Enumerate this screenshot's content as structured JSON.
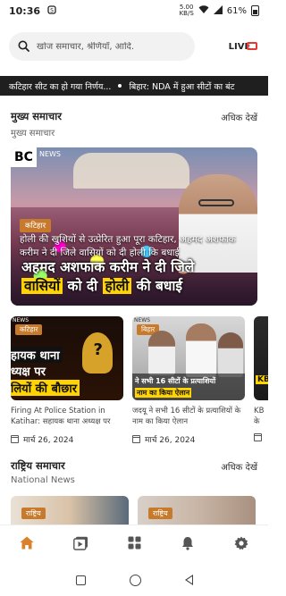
{
  "status_bar": {
    "time": "10:36",
    "speed_top": "5.00",
    "speed_bottom": "KB/S",
    "battery": "61%"
  },
  "header": {
    "search_placeholder": "खोज समाचार, श्रेणियाँ, आदि.",
    "live_label": "LIVE",
    "accent": "#e53935"
  },
  "ticker": {
    "items": [
      "कटिहार सीट का  हो गया निर्णय...",
      "बिहार: NDA में हुआ सीटों का बंट"
    ]
  },
  "main_news": {
    "title": "मुख्य समाचार",
    "subtitle": "मुख्य समाचार",
    "more_label": "अधिक देखें",
    "hero": {
      "logo_text": "BC",
      "logo_news": "NEWS",
      "tag": "कटिहार",
      "title": "होली की खुशियों से उत्प्रेरित हुआ पूरा कटिहार, अहमद अशफाक करीम ने दी जिले वासियों को दी होली कि बधाई",
      "overlay_line1": "अहमद अशफाक करीम ने दी जिले",
      "overlay_hl1": "वासियों",
      "overlay_mid": " को दी ",
      "overlay_hl2": "होली",
      "overlay_end": " की बधाई"
    },
    "cards": [
      {
        "tag": "कटिहार",
        "thumb_line1": "हायक थाना",
        "thumb_line2": "ध्यक्ष पर",
        "thumb_line3": "लियों की बौछार",
        "caption": "Firing At Police Station in Katihar: सहायक थाना अध्यक्ष पर",
        "date": "मार्च 26, 2024"
      },
      {
        "tag": "बिहार",
        "thumb_line1": "ने सभी 16 सीटों के प्रत्याशियों",
        "thumb_line2": "नाम का किया ऐलान",
        "caption": "जदयू ने सभी 16 सीटों के प्रत्याशियों के नाम का किया ऐलान",
        "date": "मार्च 26, 2024"
      },
      {
        "thumb_line1": "KB",
        "caption": "KB",
        "caption2": "के"
      }
    ]
  },
  "national_news": {
    "title": "राष्ट्रिय समाचार",
    "subtitle": "National News",
    "more_label": "अधिक देखें",
    "cards": [
      {
        "tag": "राष्ट्रिय"
      },
      {
        "tag": "राष्ट्रिय"
      }
    ]
  },
  "bottom_nav": {
    "active_color": "#d9822b",
    "items": [
      "home-icon",
      "video-icon",
      "categories-icon",
      "notifications-icon",
      "settings-icon"
    ]
  },
  "tag_color": "#c77a2c"
}
